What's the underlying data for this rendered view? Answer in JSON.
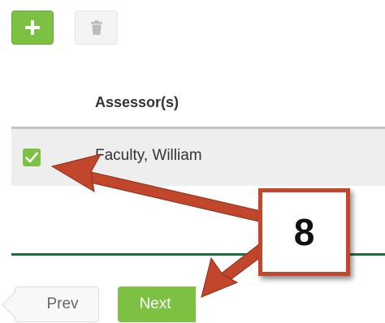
{
  "toolbar": {
    "add_icon": "plus-icon",
    "delete_icon": "trash-icon"
  },
  "table": {
    "columns": [
      "Assessor(s)"
    ],
    "rows": [
      {
        "checked": true,
        "assessor": "Faculty, William"
      }
    ]
  },
  "pagination": {
    "prev_label": "Prev",
    "next_label": "Next"
  },
  "annotation": {
    "step_number": "8",
    "color": "#c2462b"
  },
  "colors": {
    "accent": "#7cc142",
    "rule": "#1f6b42"
  }
}
